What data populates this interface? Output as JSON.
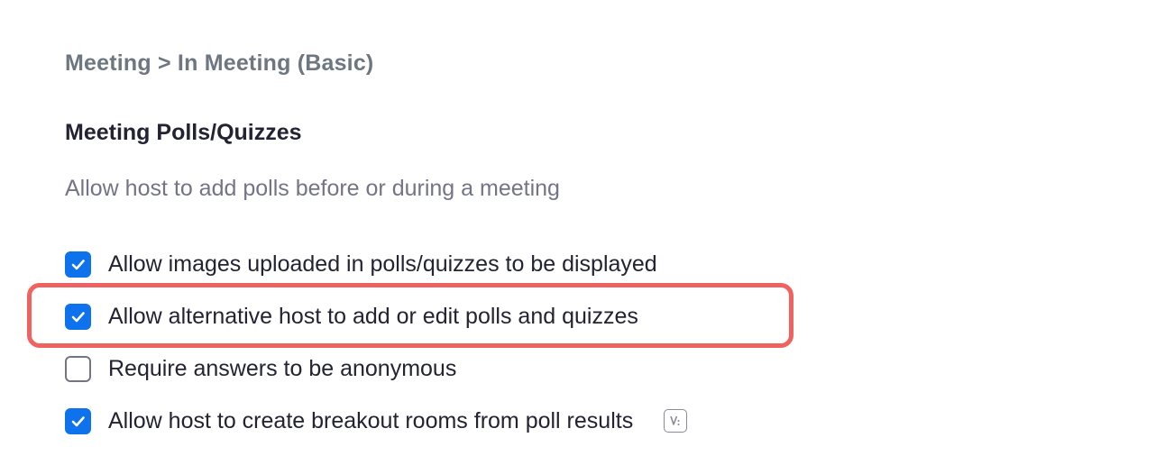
{
  "breadcrumb": "Meeting > In Meeting (Basic)",
  "section": {
    "title": "Meeting Polls/Quizzes",
    "description": "Allow host to add polls before or during a meeting"
  },
  "options": [
    {
      "label": "Allow images uploaded in polls/quizzes to be displayed",
      "checked": true
    },
    {
      "label": "Allow alternative host to add or edit polls and quizzes",
      "checked": true,
      "highlighted": true
    },
    {
      "label": "Require answers to be anonymous",
      "checked": false
    },
    {
      "label": "Allow host to create breakout rooms from poll results",
      "checked": true,
      "icon": "version-info-icon"
    }
  ],
  "colors": {
    "accent": "#0e72ed",
    "highlight": "#f0625f",
    "text": "#232333",
    "muted": "#747487"
  }
}
